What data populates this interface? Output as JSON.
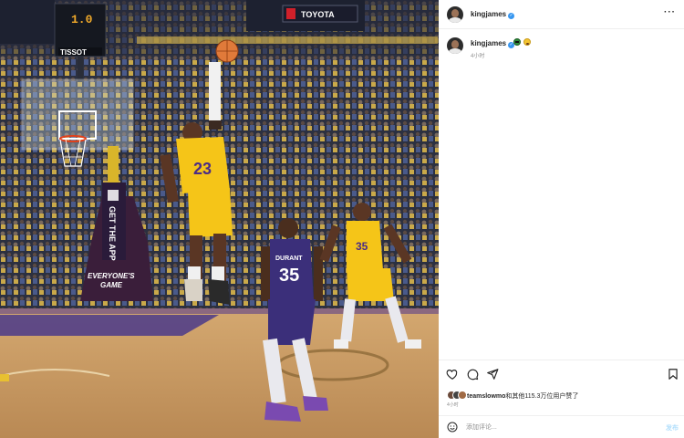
{
  "photo": {
    "alt": "Basketball game photo",
    "shot_clock": "1.0",
    "clock_sponsor": "TISSOT",
    "arena_sign": "TOYOTA",
    "player_jersey_main": "23",
    "player_jersey_right": "35",
    "defender_name": "DURANT",
    "defender_jersey": "35",
    "banner_vertical": "GET THE APP",
    "banner_bottom_line1": "EVERYONE'S",
    "banner_bottom_line2": "GAME"
  },
  "post": {
    "username": "kingjames",
    "more_icon": "more-horizontal-icon"
  },
  "caption": {
    "username": "kingjames",
    "time": "4小时"
  },
  "actions": {
    "likes_user": "teamslowmo",
    "likes_suffix": "和其他115.3万位用户赞了",
    "time": "4小时"
  },
  "comment": {
    "placeholder": "添加评论...",
    "post_label": "发布"
  },
  "colors": {
    "verified": "#3897f0",
    "lakers_gold": "#f5c518",
    "suns_purple": "#3b2f7a",
    "court_wood": "#c79a62"
  }
}
